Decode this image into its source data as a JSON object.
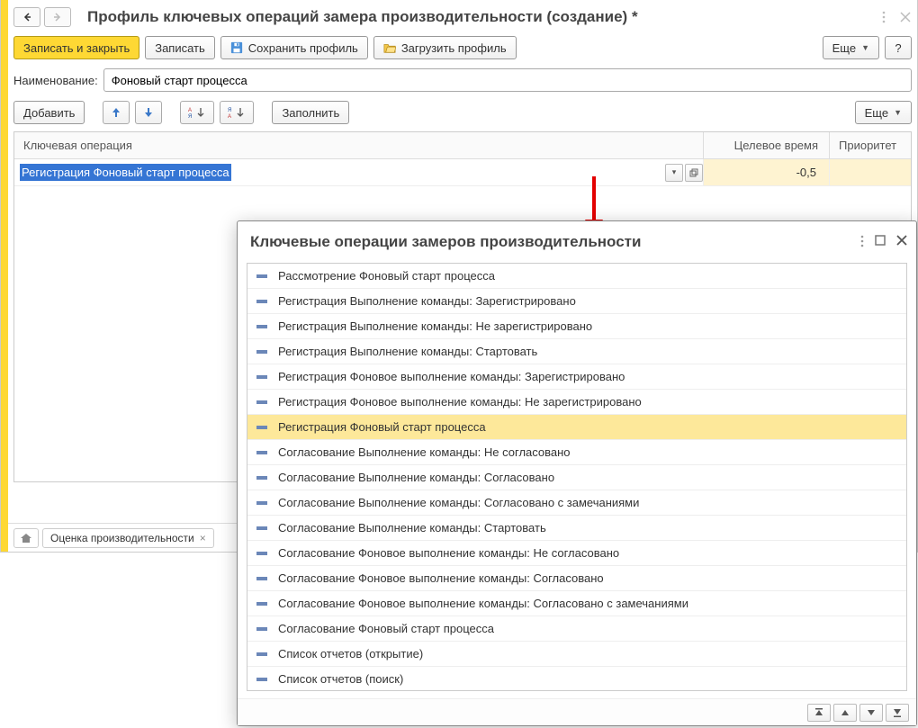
{
  "header": {
    "title": "Профиль ключевых операций замера производительности (создание) *"
  },
  "toolbar": {
    "save_close": "Записать и закрыть",
    "save": "Записать",
    "save_profile": "Сохранить профиль",
    "load_profile": "Загрузить профиль",
    "more": "Еще",
    "help": "?"
  },
  "name_field": {
    "label": "Наименование:",
    "value": "Фоновый старт процесса"
  },
  "toolbar2": {
    "add": "Добавить",
    "fill": "Заполнить",
    "more": "Еще"
  },
  "table": {
    "headers": {
      "op": "Ключевая операция",
      "target": "Целевое время",
      "priority": "Приоритет"
    },
    "row": {
      "op": "Регистрация Фоновый старт процесса",
      "target": "-0,5",
      "priority": ""
    }
  },
  "tabs": {
    "performance": "Оценка производительности"
  },
  "popup": {
    "title": "Ключевые операции замеров производительности",
    "items": [
      "Рассмотрение Фоновый старт процесса",
      "Регистрация Выполнение команды: Зарегистрировано",
      "Регистрация Выполнение команды: Не зарегистрировано",
      "Регистрация Выполнение команды: Стартовать",
      "Регистрация Фоновое выполнение команды: Зарегистрировано",
      "Регистрация Фоновое выполнение команды: Не зарегистрировано",
      "Регистрация Фоновый старт процесса",
      "Согласование Выполнение команды: Не согласовано",
      "Согласование Выполнение команды: Согласовано",
      "Согласование Выполнение команды: Согласовано с замечаниями",
      "Согласование Выполнение команды: Стартовать",
      "Согласование Фоновое выполнение команды: Не согласовано",
      "Согласование Фоновое выполнение команды: Согласовано",
      "Согласование Фоновое выполнение команды: Согласовано с замечаниями",
      "Согласование Фоновый старт процесса",
      "Список отчетов (открытие)",
      "Список отчетов (поиск)"
    ],
    "selected_index": 6
  }
}
